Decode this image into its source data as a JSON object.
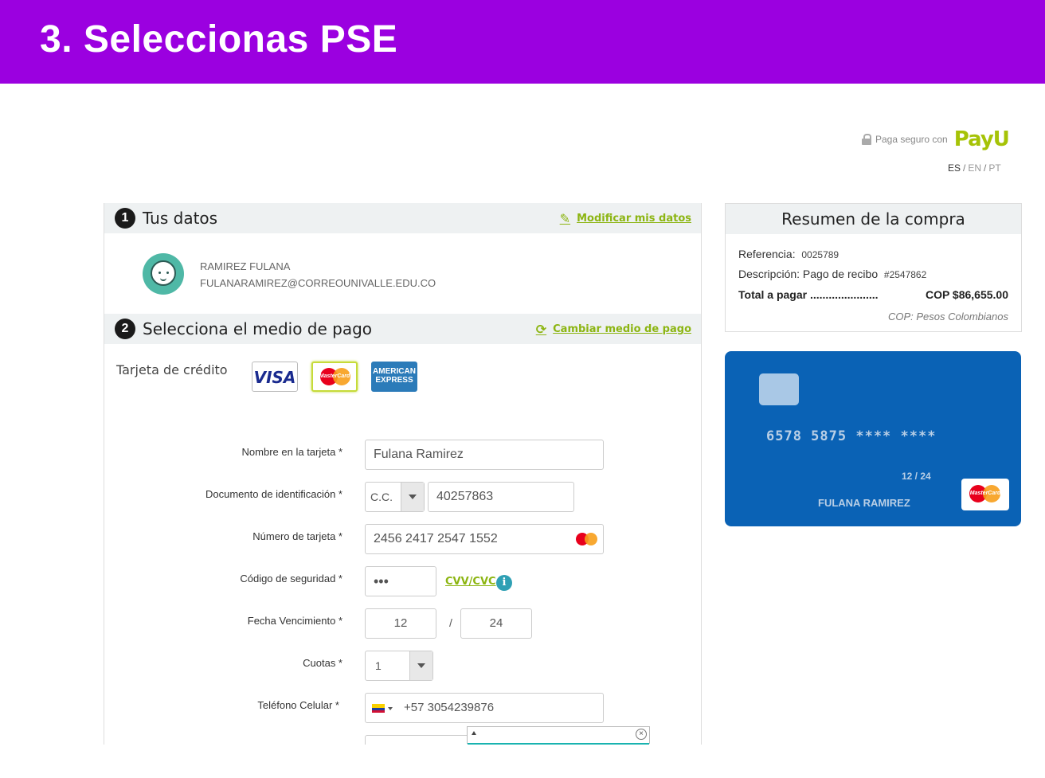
{
  "banner": {
    "title": "3. Seleccionas PSE"
  },
  "header": {
    "secure_text": "Paga seguro con",
    "brand": "PayU",
    "languages": [
      "ES",
      "EN",
      "PT"
    ]
  },
  "datos": {
    "number": "1",
    "title": "Tus datos",
    "edit_link": "Modificar mis datos",
    "name": "RAMIREZ FULANA",
    "email": "FULANARAMIREZ@CORREOUNIVALLE.EDU.CO"
  },
  "medio": {
    "number": "2",
    "title": "Selecciona el medio de pago",
    "change_link": "Cambiar medio de pago",
    "credit_label": "Tarjeta de crédito",
    "brands": {
      "visa": "VISA",
      "mastercard": "MasterCard",
      "amex": "AMERICAN EXPRESS"
    },
    "selected_brand": "mastercard"
  },
  "form": {
    "name_label": "Nombre en la tarjeta *",
    "name_value": "Fulana Ramirez",
    "doc_label": "Documento de identificación *",
    "doc_type": "C.C.",
    "doc_value": "40257863",
    "card_label": "Número de tarjeta *",
    "card_value": "2456 2417 2547 1552",
    "cvv_label": "Código de seguridad *",
    "cvv_value": "•••",
    "cvv_link": "CVV/CVC",
    "exp_label": "Fecha Vencimiento *",
    "exp_month": "12",
    "exp_sep": "/",
    "exp_year": "24",
    "cuotas_label": "Cuotas *",
    "cuotas_value": "1",
    "phone_label": "Teléfono Celular *",
    "phone_value": "+57  3054239876"
  },
  "summary": {
    "title": "Resumen de la compra",
    "ref_label": "Referencia:",
    "ref_value": "0025789",
    "desc_label": "Descripción:",
    "desc_value": "Pago de recibo",
    "desc_code": "#2547862",
    "total_label": "Total a pagar ......................",
    "total_value": "COP $86,655.00",
    "currency_note": "COP: Pesos Colombianos"
  },
  "card_preview": {
    "number": "6578  5875    ****  ****",
    "expiry": "12   /   24",
    "holder": "FULANA RAMIREZ"
  },
  "colors": {
    "banner": "#9b00e0",
    "accent": "#8cb512",
    "card": "#0a62b5"
  }
}
